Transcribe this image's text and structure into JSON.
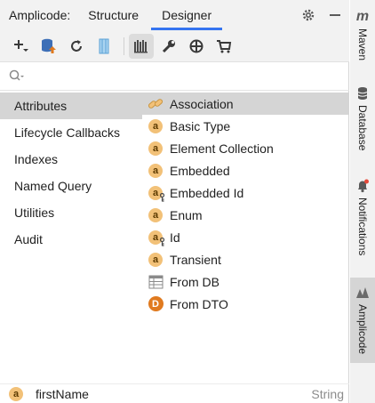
{
  "header": {
    "title": "Amplicode:",
    "tabs": [
      {
        "label": "Structure"
      },
      {
        "label": "Designer"
      }
    ]
  },
  "toolbar": {
    "buttons": [
      "add-icon",
      "database-upload-icon",
      "refresh-icon",
      "columns-icon",
      "bars-icon",
      "wrench-icon",
      "crosshair-icon",
      "cart-icon"
    ]
  },
  "search": {
    "value": "",
    "placeholder": ""
  },
  "categories": [
    {
      "label": "Attributes"
    },
    {
      "label": "Lifecycle Callbacks"
    },
    {
      "label": "Indexes"
    },
    {
      "label": "Named Query"
    },
    {
      "label": "Utilities"
    },
    {
      "label": "Audit"
    }
  ],
  "items": [
    {
      "label": "Association",
      "icon": "association-icon"
    },
    {
      "label": "Basic Type",
      "icon": "attribute-icon"
    },
    {
      "label": "Element Collection",
      "icon": "attribute-icon"
    },
    {
      "label": "Embedded",
      "icon": "attribute-icon"
    },
    {
      "label": "Embedded Id",
      "icon": "attribute-key-icon"
    },
    {
      "label": "Enum",
      "icon": "attribute-icon"
    },
    {
      "label": "Id",
      "icon": "attribute-key-icon"
    },
    {
      "label": "Transient",
      "icon": "attribute-icon"
    },
    {
      "label": "From DB",
      "icon": "table-icon"
    },
    {
      "label": "From DTO",
      "icon": "dto-icon"
    }
  ],
  "icon_letters": {
    "attribute": "a",
    "dto": "D"
  },
  "bottom": {
    "name": "firstName",
    "type": "String"
  },
  "sidebar": {
    "tabs": [
      {
        "label": "Maven",
        "icon": "maven-icon",
        "glyph": "m"
      },
      {
        "label": "Database",
        "icon": "database-icon"
      },
      {
        "label": "Notifications",
        "icon": "bell-icon"
      },
      {
        "label": "Amplicode",
        "icon": "amplicode-icon"
      }
    ]
  },
  "colors": {
    "accent": "#3574f0",
    "selection": "#d5d5d5",
    "attribute_badge": "#f2c178",
    "dto_badge": "#e07a1f",
    "notification_dot": "#e5493a"
  }
}
